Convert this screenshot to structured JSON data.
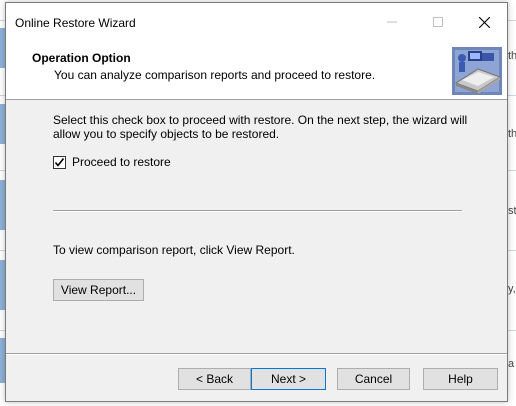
{
  "window": {
    "title": "Online Restore Wizard"
  },
  "header": {
    "title": "Operation Option",
    "subtitle": "You can analyze comparison reports and proceed to restore.",
    "icon": "wizard-restore-icon"
  },
  "main": {
    "description": "Select this check box to proceed with restore. On the next step, the wizard will allow you to specify objects to be restored.",
    "proceed_checkbox": {
      "label": "Proceed to restore",
      "checked": true
    },
    "view_report_text": "To view comparison report, click View Report.",
    "view_report_button": "View Report..."
  },
  "footer": {
    "back_label": "< Back",
    "next_label": "Next >",
    "cancel_label": "Cancel",
    "help_label": "Help"
  },
  "background": {
    "right_text": [
      "th",
      "th",
      "st",
      "y,",
      "a"
    ]
  },
  "colors": {
    "dialog_bg": "#f0f0f0",
    "header_bg": "#ffffff",
    "button_bg": "#e1e1e1",
    "default_button_border": "#0078d7"
  }
}
